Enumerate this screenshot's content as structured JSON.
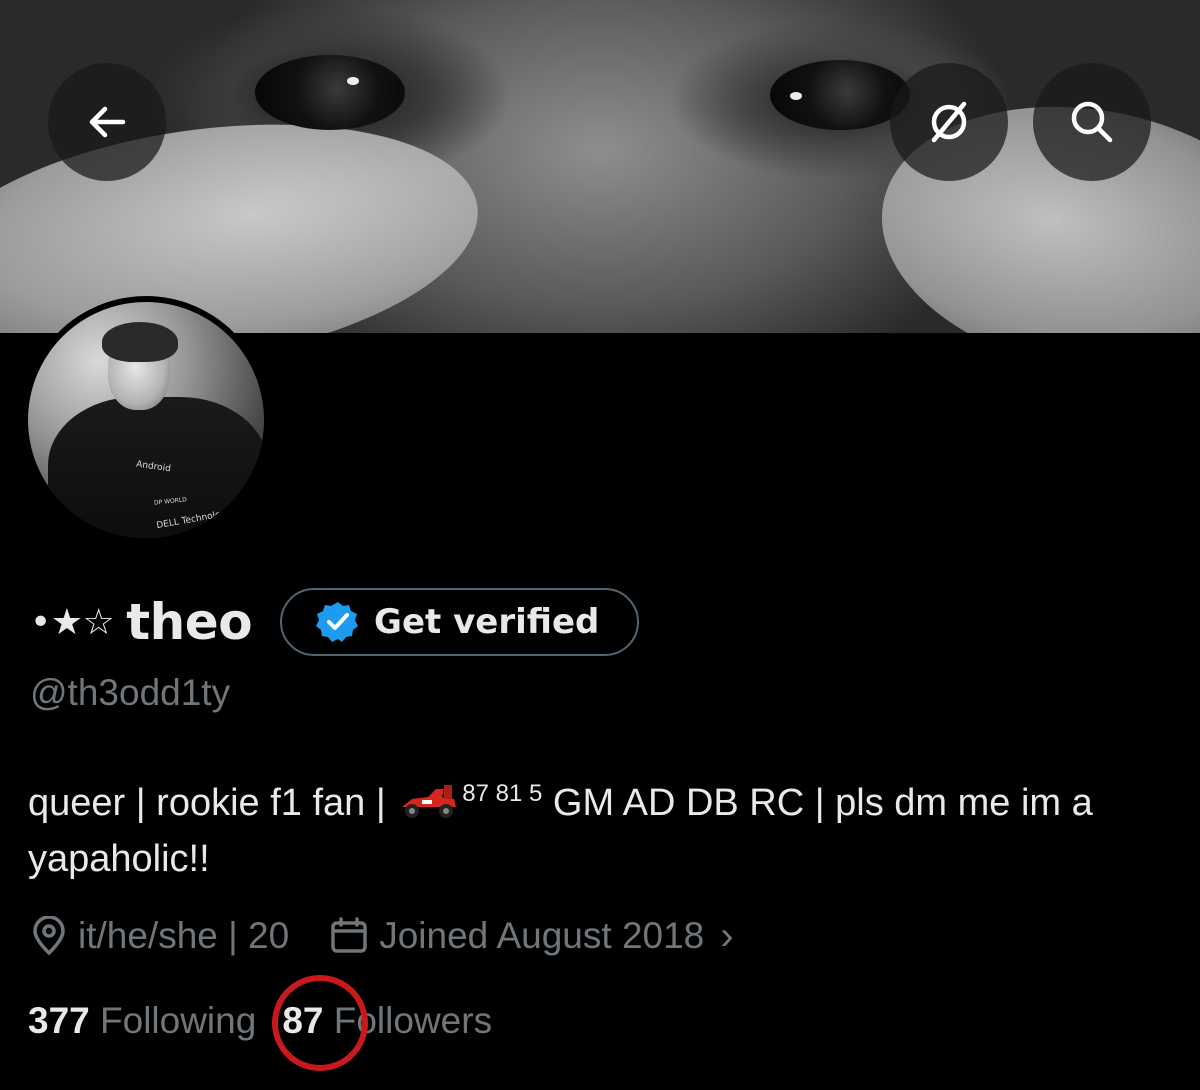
{
  "header": {
    "back_icon": "arrow-left-icon",
    "grok_icon": "slashed-circle-icon",
    "search_icon": "search-icon"
  },
  "avatar": {
    "logo_texts": [
      "Android",
      "DELL Technologies",
      "DP WORLD"
    ]
  },
  "profile": {
    "name_prefix": "•★☆",
    "name": "theo",
    "verify_button_label": "Get verified",
    "handle": "@th3odd1ty"
  },
  "bio": {
    "part1": "queer | rookie f1 fan | ",
    "sup_text": "87 81 5",
    "part2": " GM AD DB RC | pls dm me im a yapaholic!!"
  },
  "meta": {
    "location": "it/he/she | 20",
    "joined": "Joined August 2018",
    "joined_chevron": "›"
  },
  "stats": {
    "following_count": "377",
    "following_label": "Following",
    "followers_count": "87",
    "followers_label": "Followers"
  },
  "colors": {
    "background": "#000000",
    "text_primary": "#e7e9ea",
    "text_secondary": "#71767b",
    "verified_blue": "#1d9bf0",
    "annotation_red": "#c8191c"
  }
}
